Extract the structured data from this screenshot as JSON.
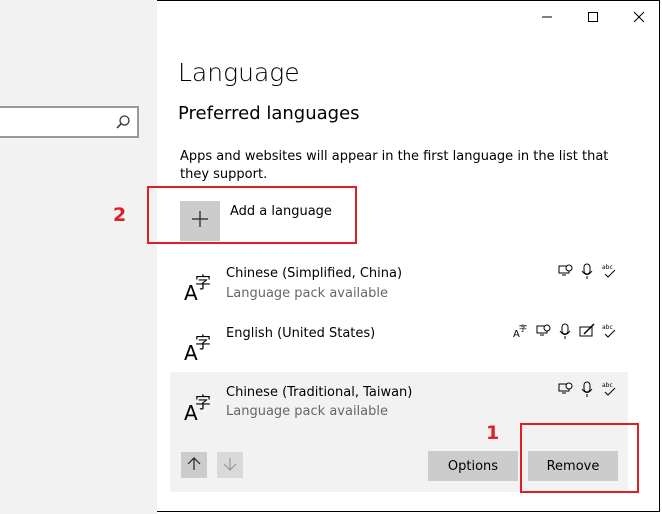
{
  "window": {
    "controls": {
      "minimize": "minimize-icon",
      "maximize": "maximize-icon",
      "close": "close-icon"
    }
  },
  "search": {
    "icon": "search-icon"
  },
  "page": {
    "title": "Language",
    "section_title": "Preferred languages",
    "description": "Apps and websites will appear in the first language in the list that they support."
  },
  "add_language": {
    "label": "Add a language",
    "icon": "plus-icon"
  },
  "languages": [
    {
      "name": "Chinese (Simplified, China)",
      "status": "Language pack available",
      "features": [
        "speech-recognition-icon",
        "microphone-icon",
        "spell-check-icon"
      ]
    },
    {
      "name": "English (United States)",
      "status": "",
      "features": [
        "display-language-icon",
        "speech-recognition-icon",
        "microphone-icon",
        "handwriting-icon",
        "spell-check-icon"
      ]
    },
    {
      "name": "Chinese (Traditional, Taiwan)",
      "status": "Language pack available",
      "features": [
        "speech-recognition-icon",
        "microphone-icon",
        "spell-check-icon"
      ]
    }
  ],
  "actions": {
    "options_label": "Options",
    "remove_label": "Remove"
  },
  "annotations": {
    "num1": "1",
    "num2": "2"
  },
  "colors": {
    "accent_annotation": "#e01e26",
    "button_bg": "#cccccc",
    "selected_row_bg": "#f2f2f2"
  }
}
